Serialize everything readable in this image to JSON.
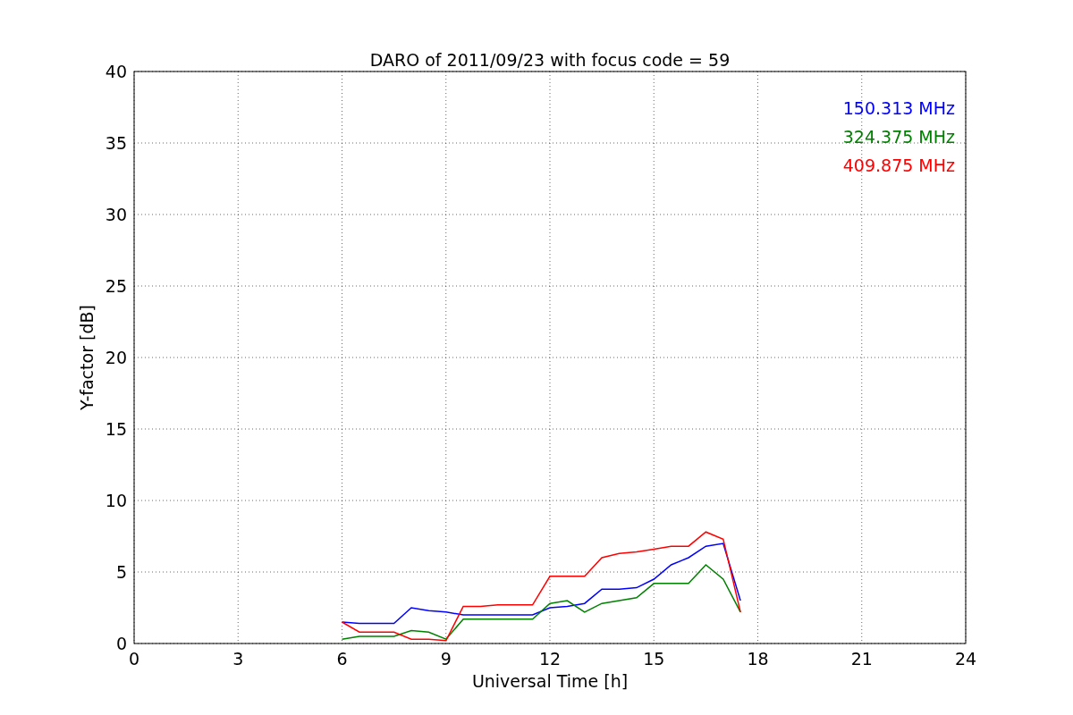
{
  "chart_data": {
    "type": "line",
    "title": "DARO of 2011/09/23 with focus code = 59",
    "xlabel": "Universal Time [h]",
    "ylabel": "Y-factor [dB]",
    "x": [
      6,
      6.5,
      7,
      7.5,
      8,
      8.5,
      9,
      9.5,
      10,
      10.5,
      11,
      11.5,
      12,
      12.5,
      13,
      13.5,
      14,
      14.5,
      15,
      15.5,
      16,
      16.5,
      17,
      17.5
    ],
    "series": [
      {
        "name": "150.313 MHz",
        "color": "#0000ff",
        "values": [
          1.5,
          1.4,
          1.4,
          1.4,
          2.5,
          2.3,
          2.2,
          2.0,
          2.0,
          2.0,
          2.0,
          2.0,
          2.5,
          2.6,
          2.8,
          3.8,
          3.8,
          3.9,
          4.5,
          5.5,
          6.0,
          6.8,
          7.0,
          3.0
        ]
      },
      {
        "name": "324.375 MHz",
        "color": "#008000",
        "values": [
          0.3,
          0.5,
          0.5,
          0.5,
          0.9,
          0.8,
          0.3,
          1.7,
          1.7,
          1.7,
          1.7,
          1.7,
          2.8,
          3.0,
          2.2,
          2.8,
          3.0,
          3.2,
          4.2,
          4.2,
          4.2,
          5.5,
          4.5,
          2.2
        ]
      },
      {
        "name": "409.875 MHz",
        "color": "#ff0000",
        "values": [
          1.5,
          0.8,
          0.8,
          0.8,
          0.3,
          0.3,
          0.2,
          2.6,
          2.6,
          2.7,
          2.7,
          2.7,
          4.7,
          4.7,
          4.7,
          6.0,
          6.3,
          6.4,
          6.6,
          6.8,
          6.8,
          7.8,
          7.3,
          2.2
        ]
      }
    ],
    "xlim": [
      0,
      24
    ],
    "ylim": [
      0,
      40
    ],
    "xticks": [
      0,
      3,
      6,
      9,
      12,
      15,
      18,
      21,
      24
    ],
    "yticks": [
      0,
      5,
      10,
      15,
      20,
      25,
      30,
      35,
      40
    ],
    "grid": true
  }
}
